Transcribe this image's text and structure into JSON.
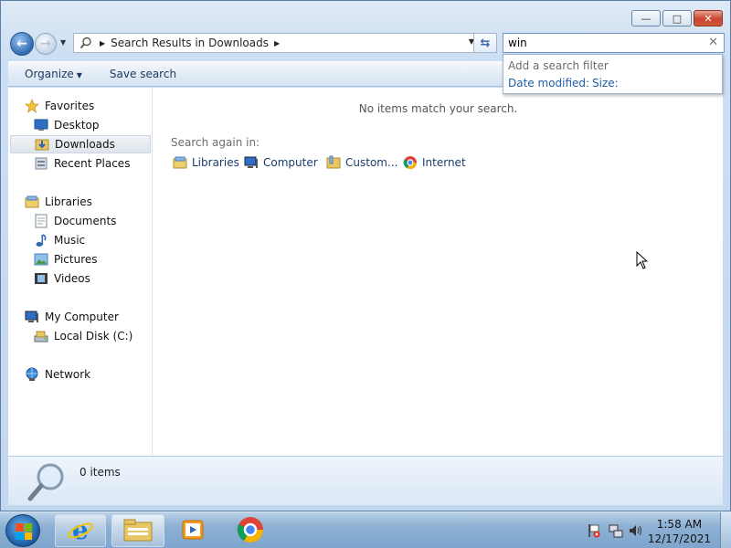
{
  "window": {
    "controls": {
      "minimize": "—",
      "maximize": "□",
      "close": "✕"
    }
  },
  "address_bar": {
    "back_icon": "arrow-left-icon",
    "forward_icon": "arrow-right-icon",
    "breadcrumb": "Search Results in Downloads"
  },
  "search": {
    "value": "win",
    "clear_icon": "close-icon",
    "suggestions": {
      "header": "Add a search filter",
      "filters": [
        "Date modified:",
        "Size:"
      ]
    }
  },
  "command_bar": {
    "organize_label": "Organize",
    "save_search_label": "Save search"
  },
  "nav_pane": {
    "favorites": {
      "label": "Favorites",
      "items": [
        "Desktop",
        "Downloads",
        "Recent Places"
      ]
    },
    "libraries": {
      "label": "Libraries",
      "items": [
        "Documents",
        "Music",
        "Pictures",
        "Videos"
      ]
    },
    "computer": {
      "label": "My Computer",
      "items": [
        "Local Disk (C:)"
      ]
    },
    "network": {
      "label": "Network"
    },
    "selected": "Downloads"
  },
  "content": {
    "empty_message": "No items match your search.",
    "search_again_label": "Search again in:",
    "search_again_items": [
      "Libraries",
      "Computer",
      "Custom...",
      "Internet"
    ]
  },
  "details_pane": {
    "count_text": "0 items"
  },
  "taskbar": {
    "clock_time": "1:58 AM",
    "clock_date": "12/17/2021",
    "apps": [
      "internet-explorer",
      "windows-explorer",
      "media-player",
      "chrome"
    ]
  }
}
